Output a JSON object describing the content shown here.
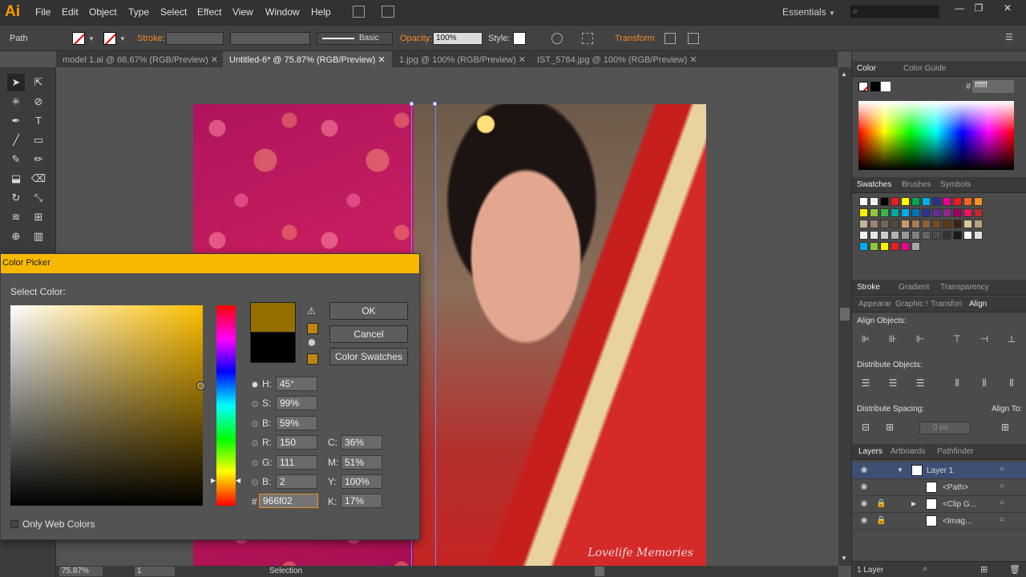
{
  "app": {
    "logo": "Ai",
    "workspace": "Essentials"
  },
  "menu": [
    "File",
    "Edit",
    "Object",
    "Type",
    "Select",
    "Effect",
    "View",
    "Window",
    "Help"
  ],
  "window_controls": {
    "minimize": "—",
    "restore": "❐",
    "close": "✕"
  },
  "controlbar": {
    "selection_type": "Path",
    "stroke_label": "Stroke:",
    "brush_label": "Basic",
    "opacity_label": "Opacity:",
    "opacity_value": "100%",
    "style_label": "Style:",
    "transform_link": "Transform"
  },
  "tabs": [
    {
      "label": "model 1.ai @ 66.67% (RGB/Preview)",
      "active": false
    },
    {
      "label": "Untitled-6* @ 75.87% (RGB/Preview)",
      "active": true
    },
    {
      "label": "1.jpg @ 100% (RGB/Preview)",
      "active": false
    },
    {
      "label": "IST_5784.jpg @ 100% (RGB/Preview)",
      "active": false
    }
  ],
  "tools": [
    "selection-tool",
    "direct-selection-tool",
    "magic-wand-tool",
    "lasso-tool",
    "pen-tool",
    "type-tool",
    "line-tool",
    "rectangle-tool",
    "paintbrush-tool",
    "blob-brush-tool",
    "eraser-tool",
    "scissors-tool",
    "rotate-tool",
    "scale-tool",
    "warp-tool",
    "free-transform-tool",
    "shape-builder-tool",
    "chart-tool"
  ],
  "artboard": {
    "photo_caption": "Lovelife Memories"
  },
  "statusbar": {
    "zoom": "75.87%",
    "artboard_number": "1",
    "mode": "Selection"
  },
  "color_panel": {
    "tabs": [
      "Color",
      "Color Guide"
    ],
    "hex_value": "ffffff"
  },
  "swatches_panel": {
    "tabs": [
      "Swatches",
      "Brushes",
      "Symbols"
    ],
    "rows": [
      [
        "#ffffff",
        "#f2f2f2",
        "#000000",
        "#ed1c24",
        "#ffff00",
        "#00a651",
        "#00aeef",
        "#2e3192",
        "#ec008c",
        "#ed1c24",
        "#f26522",
        "#f7941d"
      ],
      [
        "#fff200",
        "#8dc63f",
        "#39b54a",
        "#00a99d",
        "#00aeef",
        "#0072bc",
        "#2e3192",
        "#662d91",
        "#92278f",
        "#9e005d",
        "#ed145b",
        "#c1272d"
      ],
      [
        "#c2b59b",
        "#998675",
        "#736357",
        "#534741",
        "#c69c6d",
        "#a67c52",
        "#8c6239",
        "#754c24",
        "#603913",
        "#3c2415",
        "#d7c9a5",
        "#b7a47e"
      ],
      [
        "#f2f2f2",
        "#e6e6e6",
        "#cccccc",
        "#b3b3b3",
        "#999999",
        "#808080",
        "#666666",
        "#4d4d4d",
        "#333333",
        "#1a1a1a",
        "#ffffff",
        "#e0e0e0"
      ],
      [
        "#00aeef",
        "#8dc63f",
        "#fff200",
        "#ed1c24",
        "#ec008c",
        "#a6a6a6"
      ]
    ]
  },
  "align_panel": {
    "tabs": [
      "Stroke",
      "Gradient",
      "Transparency"
    ],
    "subtabs": [
      "Appearar",
      "Graphic !",
      "Transfori",
      "Align"
    ],
    "align_objects": "Align Objects:",
    "distribute_objects": "Distribute Objects:",
    "distribute_spacing": "Distribute Spacing:",
    "spacing_value": "0 px",
    "align_to": "Align To:"
  },
  "layers_panel": {
    "tabs": [
      "Layers",
      "Artboards",
      "Pathfinder"
    ],
    "rows": [
      {
        "name": "Layer 1",
        "locked": false,
        "expand": "▼",
        "selected": true
      },
      {
        "name": "<Path>",
        "locked": false,
        "expand": "",
        "selected": false
      },
      {
        "name": "<Clip G...",
        "locked": true,
        "expand": "▶",
        "selected": false
      },
      {
        "name": "<Imag...",
        "locked": true,
        "expand": "",
        "selected": false
      }
    ],
    "footer": "1 Layer"
  },
  "color_picker": {
    "title": "Color Picker",
    "select_label": "Select Color:",
    "new_color": "#966f02",
    "old_color": "#000000",
    "ok": "OK",
    "cancel": "Cancel",
    "swatches_btn": "Color Swatches",
    "hsb": [
      {
        "label": "H:",
        "value": "45°",
        "selected": true
      },
      {
        "label": "S:",
        "value": "99%",
        "selected": false
      },
      {
        "label": "B:",
        "value": "59%",
        "selected": false
      }
    ],
    "rgb": [
      {
        "label": "R:",
        "value": "150"
      },
      {
        "label": "G:",
        "value": "111"
      },
      {
        "label": "B:",
        "value": "2"
      }
    ],
    "cmyk": [
      {
        "label": "C:",
        "value": "36%"
      },
      {
        "label": "M:",
        "value": "51%"
      },
      {
        "label": "Y:",
        "value": "100%"
      },
      {
        "label": "K:",
        "value": "17%"
      }
    ],
    "hex_label": "#",
    "hex": "966f02",
    "web_only": "Only Web Colors",
    "warning_icon": "⚠",
    "cube_icon": "⬢"
  }
}
